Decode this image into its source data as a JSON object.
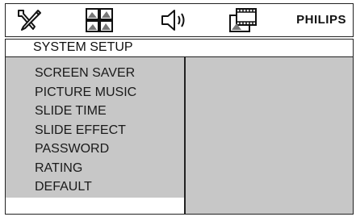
{
  "header": {
    "tabs": [
      {
        "icon": "tools-icon",
        "selected": true
      },
      {
        "icon": "picture-grid-icon",
        "selected": false
      },
      {
        "icon": "speaker-icon",
        "selected": false
      },
      {
        "icon": "film-frame-icon",
        "selected": false
      }
    ],
    "brand": "PHILIPS"
  },
  "page": {
    "title": "SYSTEM SETUP"
  },
  "menu": {
    "items": [
      "SCREEN SAVER",
      "PICTURE MUSIC",
      "SLIDE TIME",
      "SLIDE EFFECT",
      "PASSWORD",
      "RATING",
      "DEFAULT"
    ]
  },
  "colors": {
    "panel_bg": "#c7c7c7",
    "border": "#222222"
  }
}
